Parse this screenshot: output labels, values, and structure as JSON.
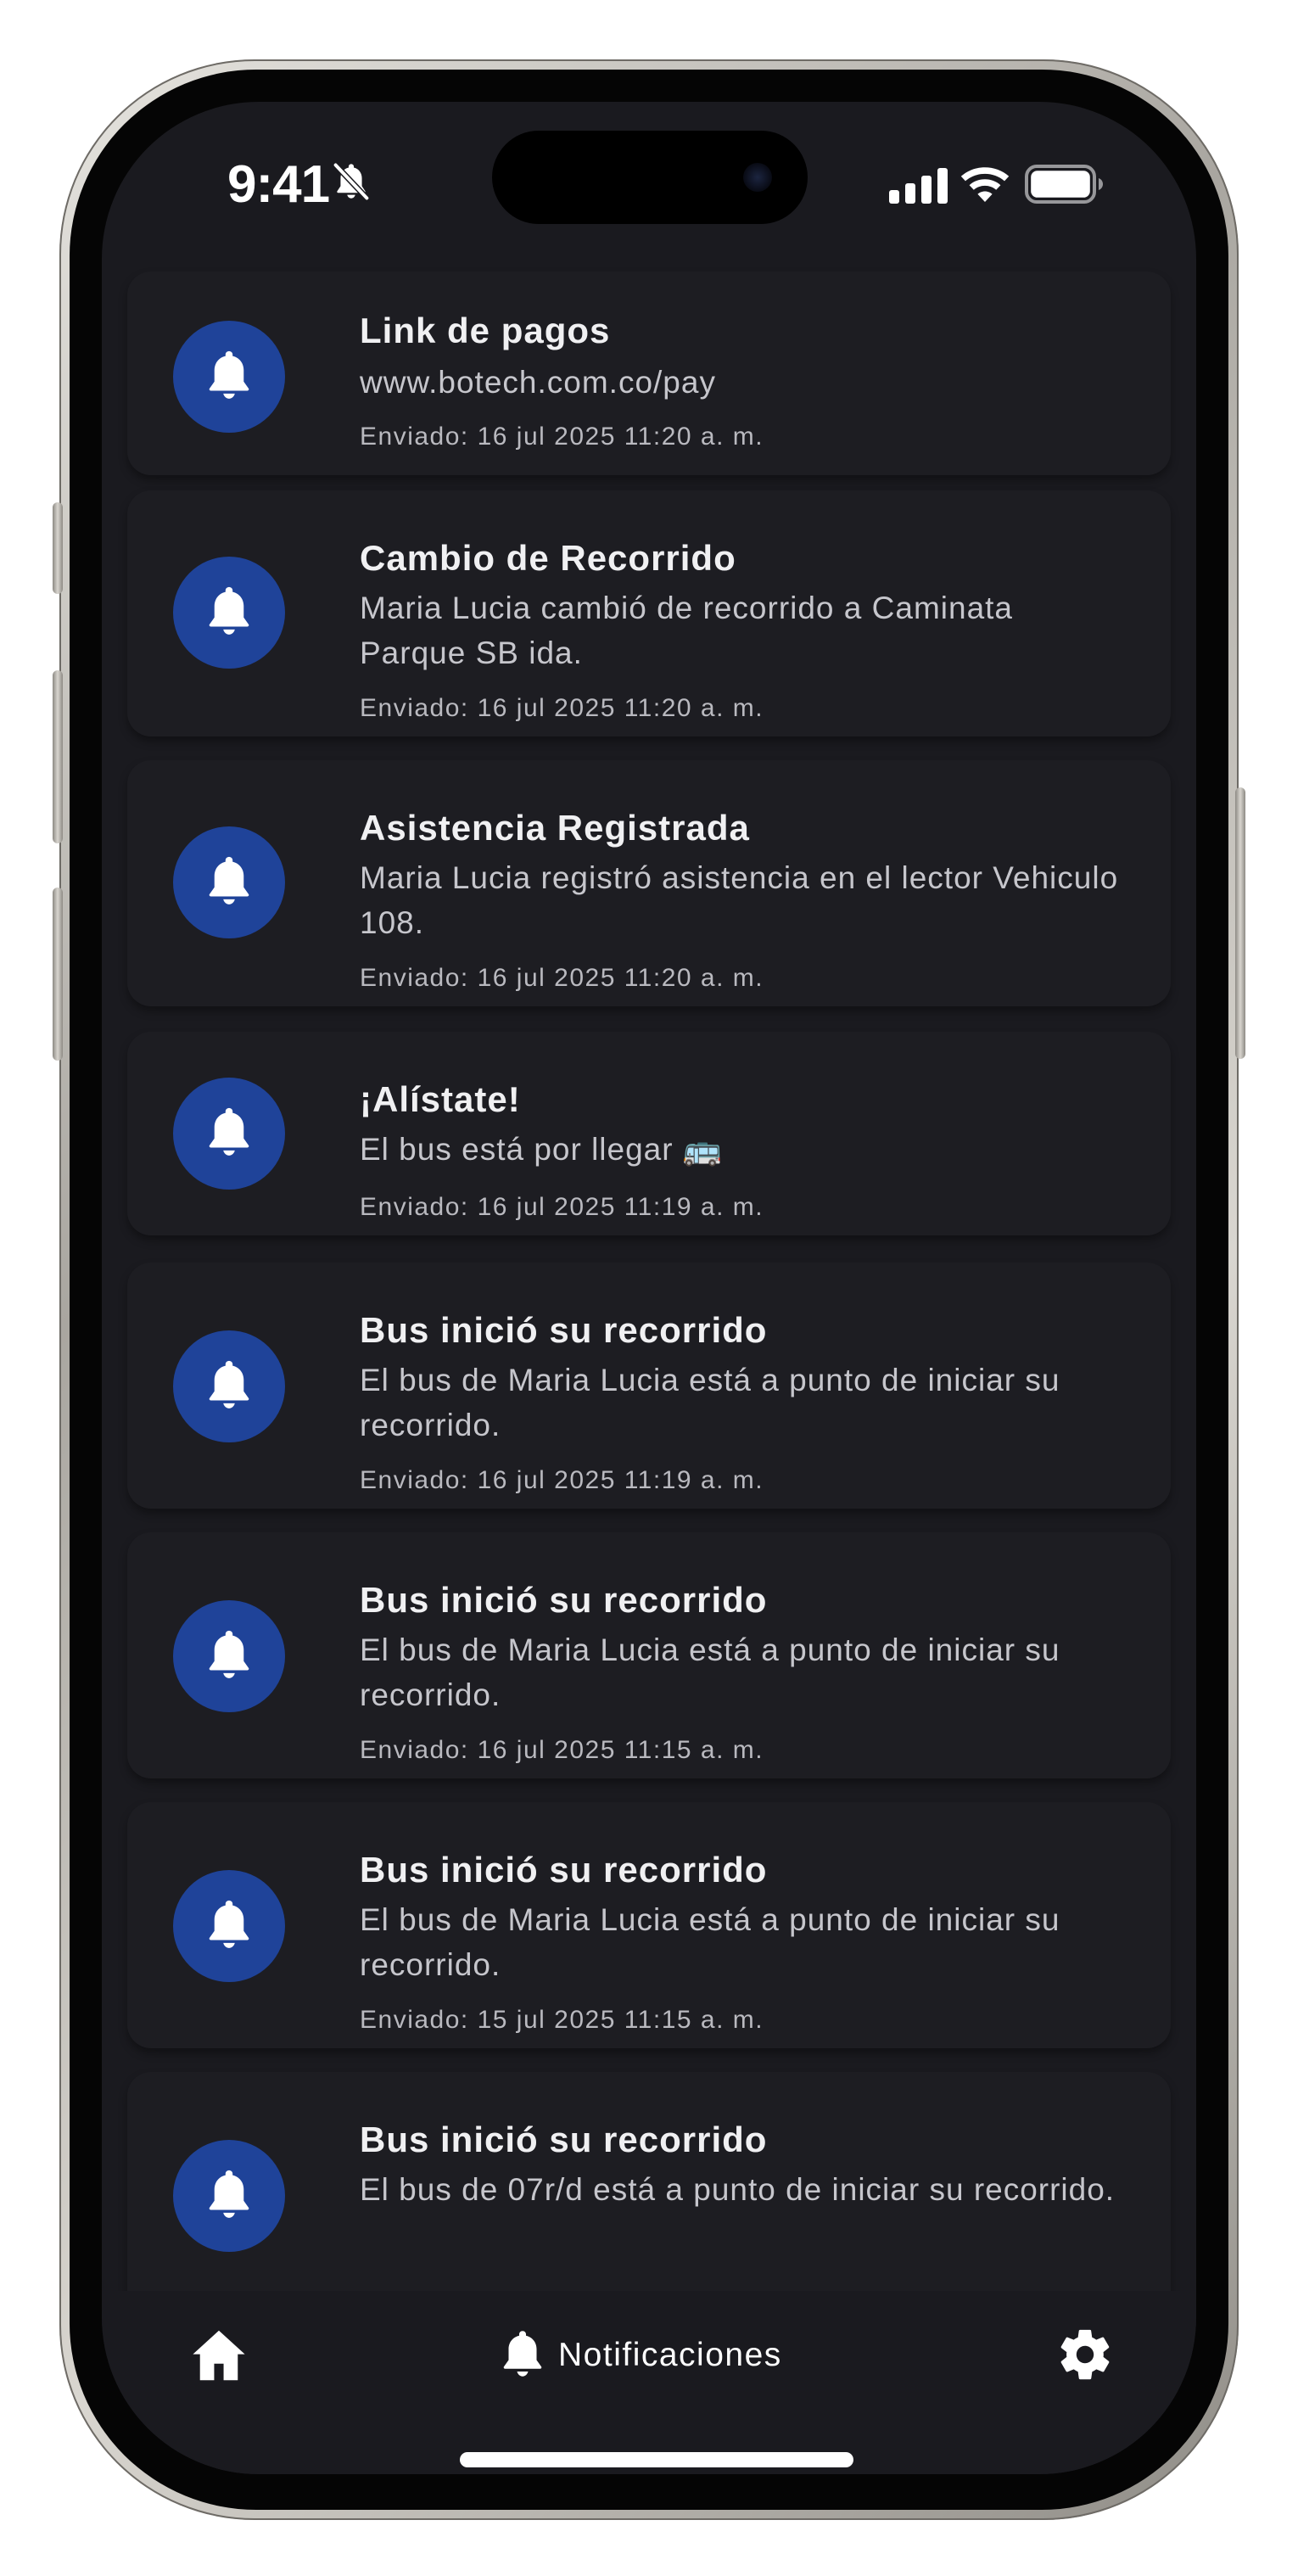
{
  "status_bar": {
    "time": "9:41"
  },
  "notifications": [
    {
      "title": "Link de pagos",
      "body": "www.botech.com.co/pay",
      "sent": "Enviado: 16 jul 2025 11:20 a. m."
    },
    {
      "title": "Cambio de Recorrido",
      "body": "Maria Lucia cambió de recorrido a Caminata Parque SB ida.",
      "sent": "Enviado: 16 jul 2025 11:20 a. m."
    },
    {
      "title": "Asistencia Registrada",
      "body": "Maria Lucia registró asistencia en el lector Vehiculo 108.",
      "sent": "Enviado: 16 jul 2025 11:20 a. m."
    },
    {
      "title": "¡Alístate!",
      "body": "El bus está por llegar 🚌",
      "sent": "Enviado: 16 jul 2025 11:19 a. m."
    },
    {
      "title": "Bus inició su recorrido",
      "body": "El bus de Maria Lucia está a punto de iniciar su recorrido.",
      "sent": "Enviado: 16 jul 2025 11:19 a. m."
    },
    {
      "title": "Bus inició su recorrido",
      "body": "El bus de Maria Lucia está a punto de iniciar su recorrido.",
      "sent": "Enviado: 16 jul 2025 11:15 a. m."
    },
    {
      "title": "Bus inició su recorrido",
      "body": "El bus de Maria Lucia está a punto de iniciar su recorrido.",
      "sent": "Enviado: 15 jul 2025 11:15 a. m."
    },
    {
      "title": "Bus inició su recorrido",
      "body": "El bus de 07r/d está a punto de iniciar su recorrido.",
      "sent": ""
    }
  ],
  "bottom_nav": {
    "home_icon": "home-icon",
    "notifications_label": "Notificaciones",
    "notifications_icon": "bell-icon",
    "settings_icon": "gear-icon"
  },
  "colors": {
    "background": "#1a1a1f",
    "card": "#1d1d22",
    "avatar": "#1f4399",
    "title": "#f0f0f2",
    "body": "#c6c6cc"
  }
}
